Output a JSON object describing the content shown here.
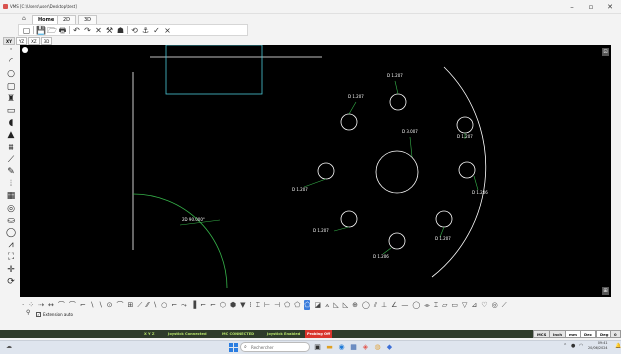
{
  "window": {
    "title": "VMS [C:\\Users\\user\\Desktop\\test]",
    "minimize": "–",
    "maximize": "▫",
    "close": "✕"
  },
  "tabs": [
    {
      "label": "Home",
      "active": true
    },
    {
      "label": "2D",
      "active": false
    },
    {
      "label": "3D",
      "active": false
    }
  ],
  "toolbar": {
    "icons": [
      "rectangle-icon",
      "save-icon",
      "open-folder-icon",
      "print-icon",
      "undo-icon",
      "redo-icon",
      "delete-icon",
      "measure-icon",
      "probe-icon",
      "rotate-icon",
      "probe-down-icon",
      "check-icon",
      "cancel-icon"
    ],
    "glyphs": [
      "▢",
      "💾",
      "🗁",
      "🖶",
      "↶",
      "↷",
      "✕",
      "⚒",
      "☗",
      "⟲",
      "⚓",
      "✓",
      "×"
    ]
  },
  "view_tabs": [
    {
      "label": "XY",
      "active": true
    },
    {
      "label": "YZ",
      "active": false
    },
    {
      "label": "XZ",
      "active": false
    },
    {
      "label": "3D",
      "active": false
    }
  ],
  "left_tools": [
    {
      "name": "point-icon",
      "glyph": "·"
    },
    {
      "name": "arc-icon",
      "glyph": "◜"
    },
    {
      "name": "circle-icon",
      "glyph": "○"
    },
    {
      "name": "rounded-rect-icon",
      "glyph": "▢"
    },
    {
      "name": "pin-icon",
      "glyph": "♜"
    },
    {
      "name": "slot-icon",
      "glyph": "▭"
    },
    {
      "name": "fill-icon",
      "glyph": "◖"
    },
    {
      "name": "triangle-icon",
      "glyph": "▲"
    },
    {
      "name": "comb-icon",
      "glyph": "⩩"
    },
    {
      "name": "knife-icon",
      "glyph": "⟋"
    },
    {
      "name": "pen-icon",
      "glyph": "✎"
    },
    {
      "name": "path-icon",
      "glyph": "⦙"
    },
    {
      "name": "grid-icon",
      "glyph": "▦"
    },
    {
      "name": "target-icon",
      "glyph": "◎"
    },
    {
      "name": "hat-icon",
      "glyph": "⛀"
    },
    {
      "name": "sphere-icon",
      "glyph": "◯"
    },
    {
      "name": "cone-icon",
      "glyph": "⩘"
    },
    {
      "name": "frame-icon",
      "glyph": "⛶"
    },
    {
      "name": "cross-icon",
      "glyph": "✛"
    },
    {
      "name": "rotate-view-icon",
      "glyph": "⟳"
    }
  ],
  "canvas": {
    "dimensions": [
      {
        "id": "d1",
        "text": "D 1.207"
      },
      {
        "id": "d2",
        "text": "D 1.207"
      },
      {
        "id": "d3",
        "text": "D 3.007"
      },
      {
        "id": "d4",
        "text": "D 1.207"
      },
      {
        "id": "d5",
        "text": "D 1.207"
      },
      {
        "id": "d6",
        "text": "D 1.206"
      },
      {
        "id": "d7",
        "text": "D 1.207"
      },
      {
        "id": "d8",
        "text": "D 1.207"
      },
      {
        "id": "d9",
        "text": "D 1.206"
      },
      {
        "id": "angle",
        "text": "2D 90.000°"
      }
    ]
  },
  "extension_bar": {
    "glyphs": [
      "·",
      "⁘",
      "⇢",
      "↔",
      "⌒",
      "⌒",
      "⌐",
      "∖",
      "∖",
      "⊙",
      "⌒",
      "⊞",
      "⟋",
      "⁄⁄",
      "∖",
      "○",
      "⌐",
      "⤳",
      "▐",
      "⌐",
      "⌐",
      "⬡",
      "⬢",
      "▼",
      "⁞",
      "⌶",
      "⊢",
      "⊣",
      "⬠",
      "⬠",
      "⬠",
      "◪",
      "⟑",
      "◺",
      "◺",
      "⊕",
      "◯",
      "⫽",
      "⊥",
      "∠",
      "—",
      "◯",
      "⌯",
      "⌶",
      "▱",
      "▭",
      "▽",
      "⊿",
      "♡",
      "◎",
      "⟋"
    ],
    "active_index": 30,
    "checkbox_label": "Extension auto",
    "checkbox_checked": true
  },
  "status": {
    "xyz": "X Y Z",
    "joystick": "Joystick Connected",
    "mc": "MC CONNECTED",
    "joystick_enabled": "Joystick Enabled",
    "probing": "Probing Off",
    "units": [
      {
        "label": "MCS",
        "active": false
      },
      {
        "label": "Inch",
        "active": false
      },
      {
        "label": "mm",
        "active": true
      },
      {
        "label": "Dec",
        "active": true
      },
      {
        "label": "Deg",
        "active": true
      },
      {
        "label": "0",
        "active": false
      }
    ]
  },
  "taskbar": {
    "search_placeholder": "Rechercher",
    "time": "09:41",
    "date": "20/06/2024",
    "colors": {
      "start": "#2a7de1",
      "accent_green": "#b6e36a",
      "probing_off": "#d9342b"
    }
  }
}
